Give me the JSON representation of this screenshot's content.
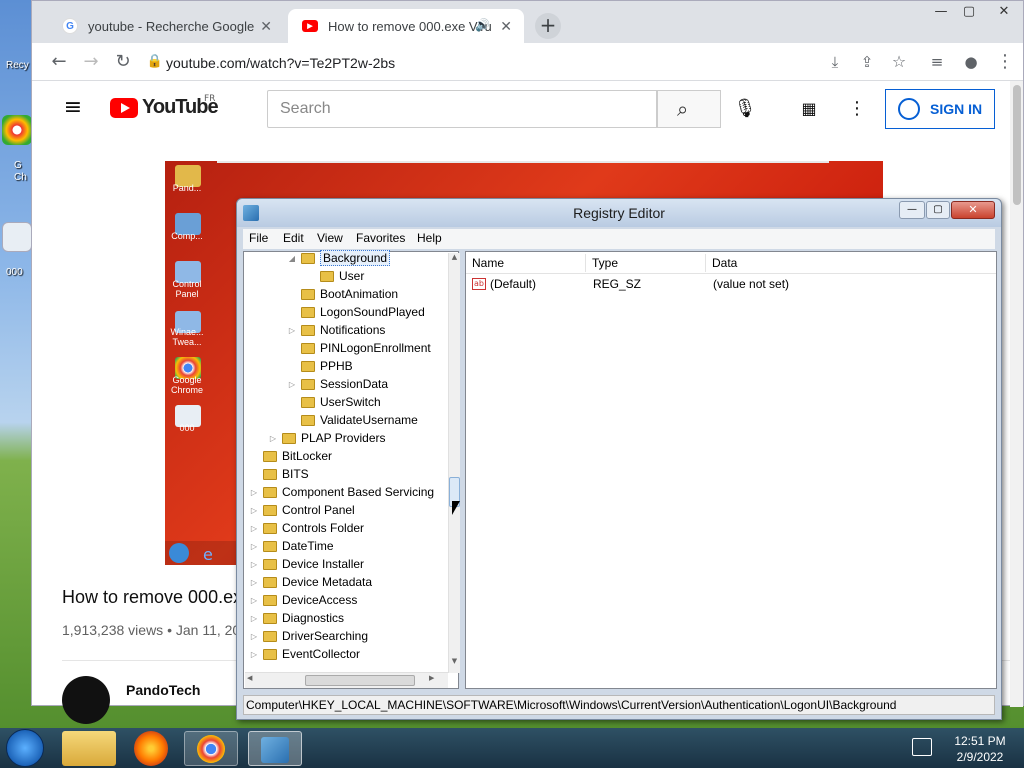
{
  "desktop": {
    "icons": [
      {
        "label": "Recy",
        "name": "recycle-bin-icon"
      },
      {
        "label": "G\nCh",
        "name": "google-chrome-desktop-icon"
      },
      {
        "label": "000",
        "name": "file-000-desktop-icon"
      }
    ]
  },
  "browser": {
    "tabs": [
      {
        "title": "youtube - Recherche Google",
        "favicon": "google-g-icon"
      },
      {
        "title": "How to remove 000.exe Viru",
        "favicon": "youtube-icon"
      }
    ],
    "url": "youtube.com/watch?v=Te2PT2w-2bs"
  },
  "youtube": {
    "logo_text": "YouTube",
    "region": "FR",
    "search_placeholder": "Search",
    "sign_in_label": "SIGN IN",
    "video_title": "How to remove 000.exe",
    "video_meta": "1,913,238 views • Jan 11, 20",
    "channel_name": "PandoTech"
  },
  "video_desktop": {
    "icons": [
      {
        "label": "Pand...",
        "name": "folder-icon",
        "color": "#e2b84a"
      },
      {
        "label": "Comp...",
        "name": "computer-icon",
        "color": "#6a9fd6"
      },
      {
        "label": "Control\nPanel",
        "name": "control-panel-icon",
        "color": "#8fb8e6"
      },
      {
        "label": "Winae...\nTwea...",
        "name": "tweaker-icon",
        "color": "#8fb8e6"
      },
      {
        "label": "Google\nChrome",
        "name": "chrome-icon",
        "color": "#ffffff"
      },
      {
        "label": "000",
        "name": "file-icon",
        "color": "#ffffff"
      }
    ]
  },
  "regedit": {
    "title": "Registry Editor",
    "menu": [
      "File",
      "Edit",
      "View",
      "Favorites",
      "Help"
    ],
    "tree": [
      {
        "label": "Background",
        "level": 3,
        "expander": "open",
        "selected": true
      },
      {
        "label": "User",
        "level": 4,
        "expander": "none",
        "selected": false
      },
      {
        "label": "BootAnimation",
        "level": 3,
        "expander": "none",
        "selected": false
      },
      {
        "label": "LogonSoundPlayed",
        "level": 3,
        "expander": "none",
        "selected": false
      },
      {
        "label": "Notifications",
        "level": 3,
        "expander": "closed",
        "selected": false
      },
      {
        "label": "PINLogonEnrollment",
        "level": 3,
        "expander": "none",
        "selected": false
      },
      {
        "label": "PPHB",
        "level": 3,
        "expander": "none",
        "selected": false
      },
      {
        "label": "SessionData",
        "level": 3,
        "expander": "closed",
        "selected": false
      },
      {
        "label": "UserSwitch",
        "level": 3,
        "expander": "none",
        "selected": false
      },
      {
        "label": "ValidateUsername",
        "level": 3,
        "expander": "none",
        "selected": false
      },
      {
        "label": "PLAP Providers",
        "level": 2,
        "expander": "closed",
        "selected": false
      },
      {
        "label": "BitLocker",
        "level": 1,
        "expander": "none",
        "selected": false
      },
      {
        "label": "BITS",
        "level": 1,
        "expander": "none",
        "selected": false
      },
      {
        "label": "Component Based Servicing",
        "level": 1,
        "expander": "closed",
        "selected": false
      },
      {
        "label": "Control Panel",
        "level": 1,
        "expander": "closed",
        "selected": false
      },
      {
        "label": "Controls Folder",
        "level": 1,
        "expander": "closed",
        "selected": false
      },
      {
        "label": "DateTime",
        "level": 1,
        "expander": "closed",
        "selected": false
      },
      {
        "label": "Device Installer",
        "level": 1,
        "expander": "closed",
        "selected": false
      },
      {
        "label": "Device Metadata",
        "level": 1,
        "expander": "closed",
        "selected": false
      },
      {
        "label": "DeviceAccess",
        "level": 1,
        "expander": "closed",
        "selected": false
      },
      {
        "label": "Diagnostics",
        "level": 1,
        "expander": "closed",
        "selected": false
      },
      {
        "label": "DriverSearching",
        "level": 1,
        "expander": "closed",
        "selected": false
      },
      {
        "label": "EventCollector",
        "level": 1,
        "expander": "closed",
        "selected": false
      }
    ],
    "columns": [
      "Name",
      "Type",
      "Data"
    ],
    "values": [
      {
        "name": "(Default)",
        "type": "REG_SZ",
        "data": "(value not set)"
      }
    ],
    "status_path": "Computer\\HKEY_LOCAL_MACHINE\\SOFTWARE\\Microsoft\\Windows\\CurrentVersion\\Authentication\\LogonUI\\Background"
  },
  "taskbar": {
    "time": "12:51 PM",
    "date": "2/9/2022"
  }
}
